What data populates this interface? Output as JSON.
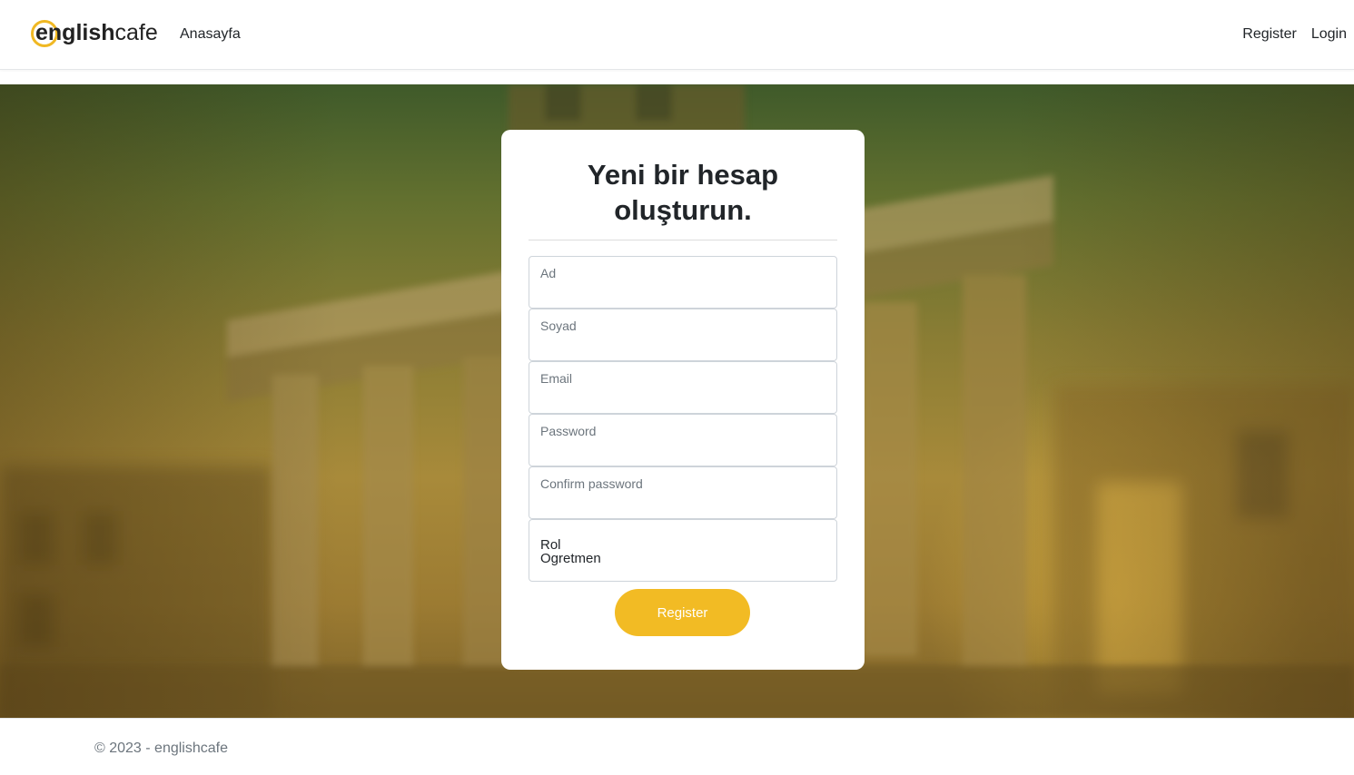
{
  "header": {
    "brand_bold": "english",
    "brand_light": "cafe",
    "nav_home": "Anasayfa",
    "nav_register": "Register",
    "nav_login": "Login"
  },
  "form": {
    "title_line1": "Yeni bir hesap",
    "title_line2": "oluşturun.",
    "fields": [
      {
        "label": "Ad"
      },
      {
        "label": "Soyad"
      },
      {
        "label": "Email"
      },
      {
        "label": "Password"
      },
      {
        "label": "Confirm password"
      }
    ],
    "role": {
      "label": "Rol",
      "value": "Ogretmen"
    },
    "submit_label": "Register"
  },
  "footer": {
    "copyright": "© 2023 - englishcafe"
  },
  "colors": {
    "accent": "#f2bb24",
    "hero_top": "#3f5a2a",
    "hero_bottom": "#9c7b32"
  }
}
